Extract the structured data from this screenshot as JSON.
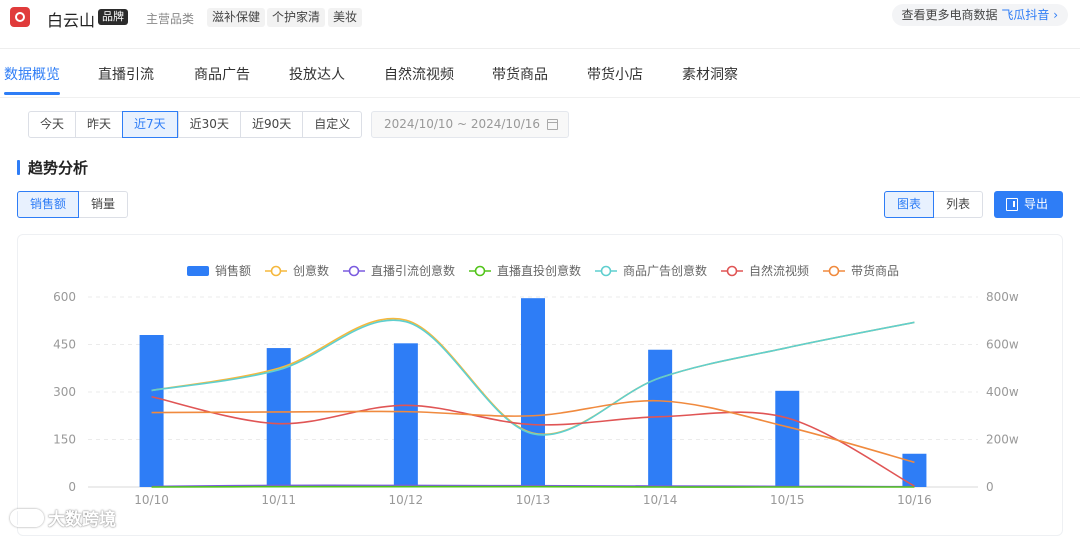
{
  "header": {
    "brand_name": "白云山",
    "brand_tag": "品牌",
    "category_label": "主营品类",
    "categories": [
      "滋补保健",
      "个护家清",
      "美妆"
    ],
    "more_link_text": "查看更多电商数据",
    "more_link_accent": "飞瓜抖音 ›"
  },
  "tabs": [
    "数据概览",
    "直播引流",
    "商品广告",
    "投放达人",
    "自然流视频",
    "带货商品",
    "带货小店",
    "素材洞察"
  ],
  "active_tab": 0,
  "filters": {
    "ranges": [
      "今天",
      "昨天",
      "近7天",
      "近30天",
      "近90天",
      "自定义"
    ],
    "active_range": 2,
    "date_range": "2024/10/10 ~ 2024/10/16"
  },
  "section": {
    "title": "趋势分析",
    "metrics": [
      "销售额",
      "销量"
    ],
    "active_metric": 0,
    "views": [
      "图表",
      "列表"
    ],
    "active_view": 0,
    "export_label": "导出"
  },
  "watermark": "大数跨境",
  "colors": {
    "accent": "#2e7df6",
    "bar": "#2e7df6",
    "创意数": "#f5b83d",
    "直播引流创意数": "#7b5cdf",
    "直播直投创意数": "#52c41a",
    "商品广告创意数": "#5fcfcf",
    "自然流视频": "#e05555",
    "带货商品": "#f08a3e"
  },
  "chart_data": {
    "type": "bar",
    "categories": [
      "10/10",
      "10/11",
      "10/12",
      "10/13",
      "10/14",
      "10/15",
      "10/16"
    ],
    "legend_position": "top-center",
    "y_left": {
      "ticks": [
        "0",
        "150",
        "300",
        "450",
        "600"
      ],
      "ylim": [
        0,
        600
      ]
    },
    "y_right": {
      "ticks": [
        "0",
        "200w",
        "400w",
        "600w",
        "800w"
      ],
      "ylim": [
        0,
        800
      ]
    },
    "grid": true,
    "series": [
      {
        "name": "销售额",
        "type": "bar",
        "axis": "right",
        "values": [
          640,
          585,
          605,
          795,
          578,
          405,
          140
        ]
      },
      {
        "name": "创意数",
        "type": "line",
        "axis": "left",
        "values": [
          305,
          375,
          527,
          170,
          345,
          440,
          520
        ]
      },
      {
        "name": "直播引流创意数",
        "type": "line",
        "axis": "left",
        "values": [
          2,
          5,
          5,
          4,
          3,
          2,
          1
        ]
      },
      {
        "name": "直播直投创意数",
        "type": "line",
        "axis": "left",
        "values": [
          0,
          1,
          1,
          1,
          0,
          0,
          0
        ]
      },
      {
        "name": "商品广告创意数",
        "type": "line",
        "axis": "left",
        "values": [
          305,
          370,
          522,
          168,
          345,
          440,
          520
        ]
      },
      {
        "name": "自然流视频",
        "type": "line",
        "axis": "left",
        "values": [
          285,
          200,
          258,
          197,
          222,
          218,
          3
        ]
      },
      {
        "name": "带货商品",
        "type": "line",
        "axis": "left",
        "values": [
          235,
          237,
          238,
          225,
          272,
          190,
          78
        ]
      }
    ]
  }
}
